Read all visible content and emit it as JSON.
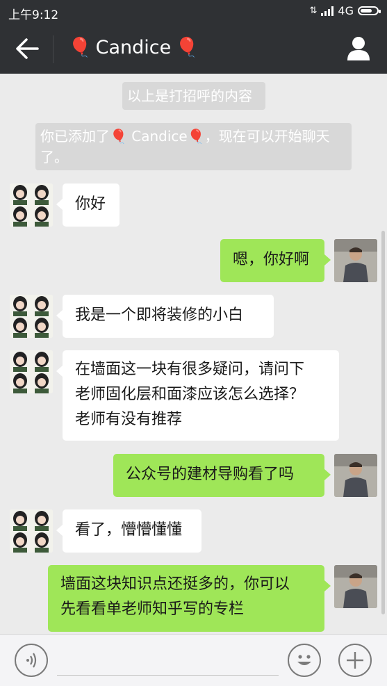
{
  "status_bar": {
    "time": "上午9:12",
    "network": "4G"
  },
  "header": {
    "title": "Candice",
    "title_emoji": "🎈"
  },
  "system_messages": [
    {
      "text": "以上是打招呼的内容"
    },
    {
      "text": "你已添加了🎈 Candice🎈，现在可以开始聊天了。"
    }
  ],
  "messages": [
    {
      "sender": "contact",
      "text": "你好"
    },
    {
      "sender": "me",
      "text": "嗯，你好啊"
    },
    {
      "sender": "contact",
      "text": "我是一个即将装修的小白"
    },
    {
      "sender": "contact",
      "lines": [
        "在墙面这一块有很多疑问，请问下",
        "老师固化层和面漆应该怎么选择？",
        "老师有没有推荐"
      ]
    },
    {
      "sender": "me",
      "text": "公众号的建材导购看了吗"
    },
    {
      "sender": "contact",
      "text": "看了，懵懵懂懂"
    },
    {
      "sender": "me",
      "lines": [
        "墙面这块知识点还挺多的，你可以",
        "先看看单老师知乎写的专栏"
      ]
    }
  ],
  "colors": {
    "header_bg": "#2f3134",
    "chat_bg": "#ebebeb",
    "outgoing_bubble": "#9fe658",
    "incoming_bubble": "#ffffff",
    "system_message_bg": "#d8d8d8"
  },
  "icons": {
    "back": "arrow-left-icon",
    "profile": "user-icon",
    "voice": "voice-icon",
    "emoji": "smiley-icon",
    "more": "plus-icon"
  }
}
